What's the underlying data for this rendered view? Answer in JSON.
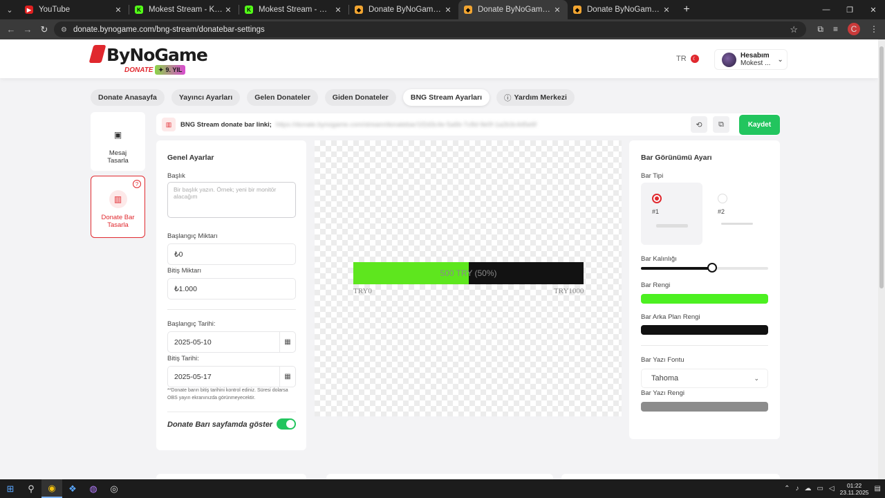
{
  "browser": {
    "tabs": [
      {
        "title": "YouTube",
        "favicon_color": "#e02020",
        "favicon": "▶"
      },
      {
        "title": "Mokest Stream - Kick Dashboard",
        "favicon_color": "#53fc18",
        "favicon": "K"
      },
      {
        "title": "Mokest Stream - Watch Live on",
        "favicon_color": "#53fc18",
        "favicon": "K"
      },
      {
        "title": "Donate ByNoGame - Streamers",
        "favicon_color": "#f2a531",
        "favicon": "◆"
      },
      {
        "title": "Donate ByNoGame - BNG Strea",
        "favicon_color": "#f2a531",
        "favicon": "◆",
        "active": true
      },
      {
        "title": "Donate ByNoGame - Streamers",
        "favicon_color": "#f2a531",
        "favicon": "◆"
      }
    ],
    "url": "donate.bynogame.com/bng-stream/donatebar-settings",
    "profile_initial": "C"
  },
  "header": {
    "logo_word": "ByNoGame",
    "logo_sub": "DONATE",
    "logo_badge": "9. YIL",
    "lang": "TR",
    "account_title": "Hesabım",
    "account_name": "Mokest ..."
  },
  "nav": [
    "Donate Anasayfa",
    "Yayıncı Ayarları",
    "Gelen Donateler",
    "Giden Donateler",
    "BNG Stream Ayarları",
    "Yardım Merkezi"
  ],
  "nav_active_index": 4,
  "sidebar": [
    {
      "label": "Mesaj Tasarla"
    },
    {
      "label": "Donate Bar Tasarla"
    }
  ],
  "linkbar": {
    "label": "BNG Stream donate bar linki;",
    "url": "https://donate.bynogame.com/stream/donatebar/1f2d3c4e-5a6b-7c8d-9e0f-1a2b3c4d5e6f",
    "save_label": "Kaydet"
  },
  "general": {
    "title": "Genel Ayarlar",
    "title_label": "Başlık",
    "title_placeholder": "Bir başlık yazın. Örnek; yeni bir monitör alacağım",
    "start_amount_label": "Başlangıç Miktarı",
    "start_amount": "₺0",
    "end_amount_label": "Bitiş Miktarı",
    "end_amount": "₺1.000",
    "start_date_label": "Başlangıç Tarihi:",
    "start_date": "2025-05-10",
    "end_date_label": "Bitiş Tarihi:",
    "end_date": "2025-05-17",
    "note": "**Donate barın bitiş tarihini kontrol ediniz. Süresi dolarsa OBS yayın ekranınızda görünmeyecektir.",
    "show_toggle_label": "Donate Barı sayfamda göster",
    "show_toggle_on": true
  },
  "preview": {
    "bar_text": "500 TRY (50%)",
    "progress": 0.5,
    "min_label": "TRY0",
    "max_label": "TRY1000",
    "fill_color": "#5ee61e",
    "bg_color": "#121212"
  },
  "appearance": {
    "title": "Bar Görünümü Ayarı",
    "type_label": "Bar Tipi",
    "type_options": [
      "#1",
      "#2"
    ],
    "type_selected": 0,
    "thickness_label": "Bar Kalınlığı",
    "thickness_value": 0.56,
    "color_label": "Bar Rengi",
    "color": "#4cf021",
    "bg_color_label": "Bar Arka Plan Rengi",
    "bg_color": "#111111",
    "font_label": "Bar Yazı Fontu",
    "font_value": "Tahoma",
    "text_color_label": "Bar Yazı Rengi",
    "text_color": "#8c8c8c"
  },
  "taskbar": {
    "time": "01:22",
    "date": "23.11.2025"
  }
}
